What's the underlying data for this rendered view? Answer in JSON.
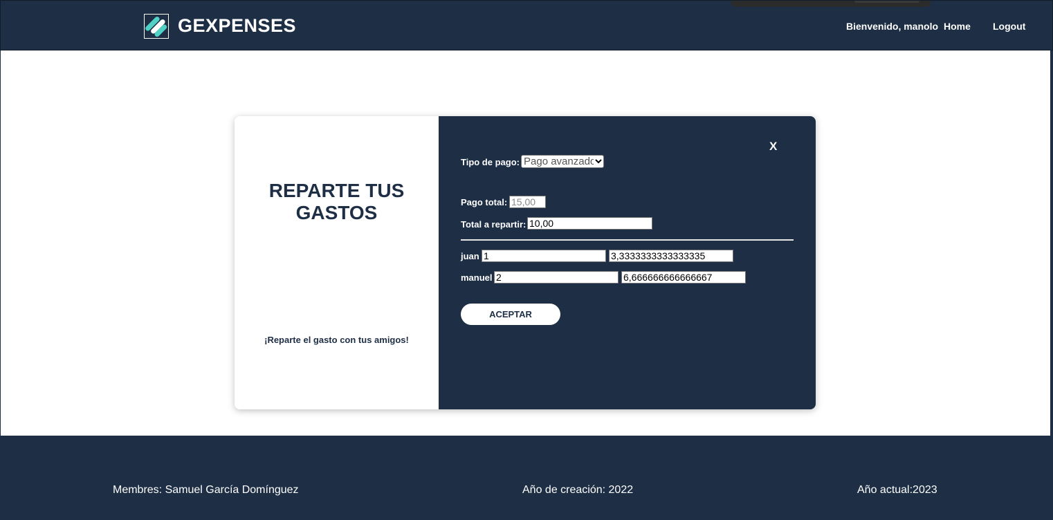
{
  "header": {
    "brand": "GEXPENSES",
    "welcome": "Bienvenido, manolo",
    "nav_home": "Home",
    "nav_logout": "Logout"
  },
  "modal": {
    "title_line1": "REPARTE TUS",
    "title_line2": "GASTOS",
    "tagline": "¡Reparte el gasto con tus amigos!",
    "close_label": "X",
    "payment_type_label": "Tipo de pago:",
    "payment_type_value": "Pago avanzado",
    "total_label": "Pago total:",
    "total_value": "15,00",
    "split_label": "Total a repartir:",
    "split_value": "10,00",
    "members": [
      {
        "name": "juan",
        "share": "1",
        "amount": "3,3333333333333335"
      },
      {
        "name": "manuel",
        "share": "2",
        "amount": "6,666666666666667"
      }
    ],
    "accept_label": "ACEPTAR"
  },
  "footer": {
    "members": "Membres: Samuel García Domínguez",
    "created": "Año de creación: 2022",
    "current": "Año actual:2023"
  },
  "colors": {
    "navy": "#1d2e45",
    "white": "#ffffff",
    "logo_accent": "#4fd1c5"
  },
  "icons": {
    "logo": "gexpenses-logo-icon",
    "select_chevron": "chevron-down-icon"
  }
}
